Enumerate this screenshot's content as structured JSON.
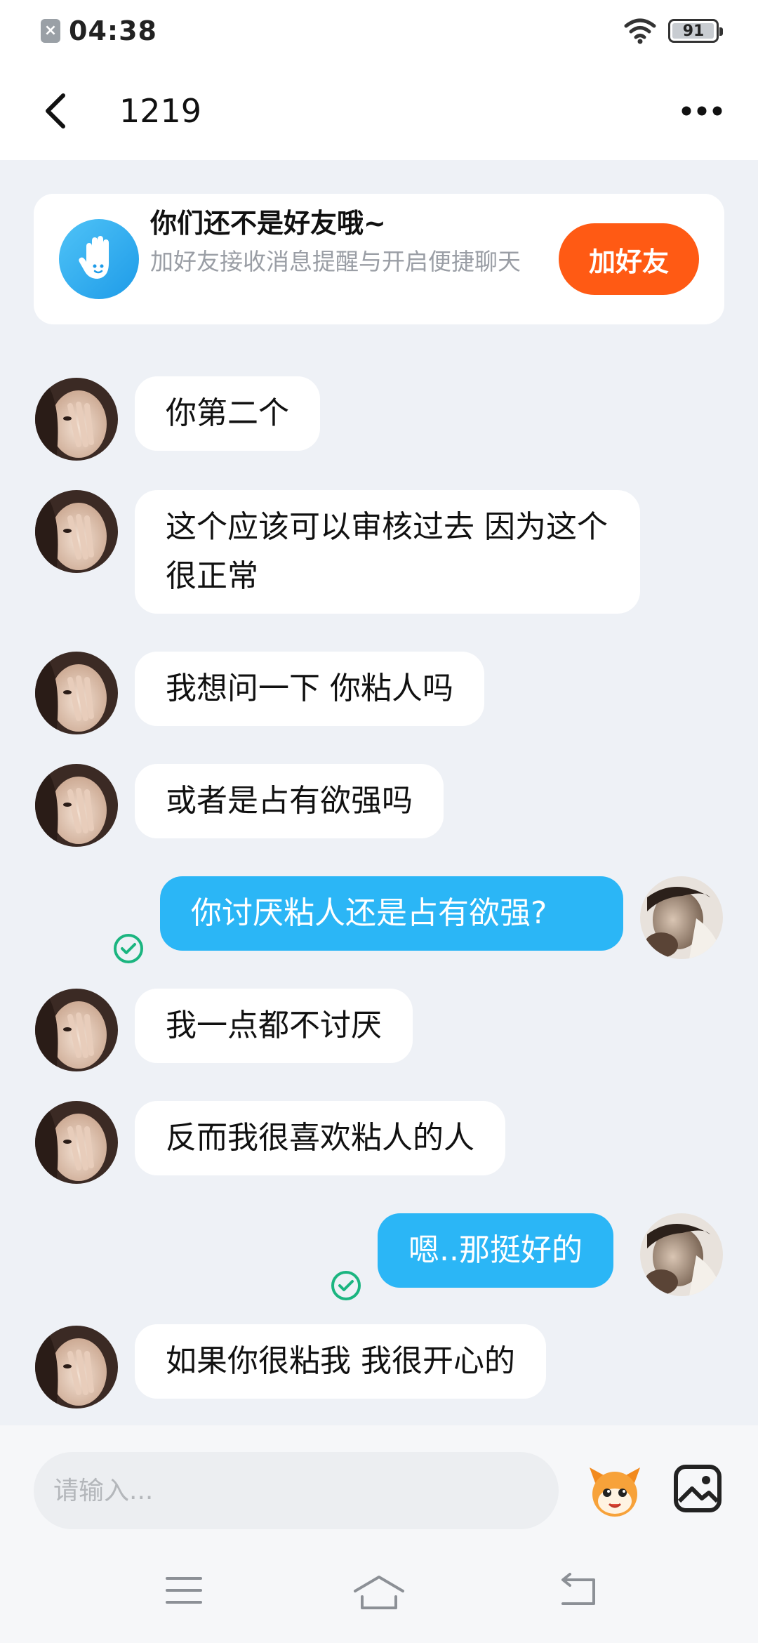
{
  "status_bar": {
    "time": "04:38",
    "battery_level": "91",
    "icons": [
      "notification-dismissed-icon",
      "wifi-icon",
      "battery-icon"
    ]
  },
  "header": {
    "title": "1219",
    "back_icon": "chevron-left-icon",
    "more_icon": "more-dots-icon"
  },
  "friend_banner": {
    "title": "你们还不是好友哦~",
    "subtitle": "加好友接收消息提醒与开启便捷聊天",
    "button_label": "加好友",
    "icon": "hand-wave-icon"
  },
  "messages": [
    {
      "side": "left",
      "text": "你第二个"
    },
    {
      "side": "left",
      "text": "这个应该可以审核过去 因为这个很正常"
    },
    {
      "side": "left",
      "text": "我想问一下 你粘人吗"
    },
    {
      "side": "left",
      "text": "或者是占有欲强吗"
    },
    {
      "side": "right",
      "text": "你讨厌粘人还是占有欲强?",
      "status": "sent"
    },
    {
      "side": "left",
      "text": "我一点都不讨厌"
    },
    {
      "side": "left",
      "text": "反而我很喜欢粘人的人"
    },
    {
      "side": "right",
      "text": "嗯..那挺好的",
      "status": "sent"
    },
    {
      "side": "left",
      "text": "如果你很粘我 我很开心的"
    }
  ],
  "input": {
    "placeholder": "请输入...",
    "value": ""
  },
  "toolbar": {
    "icons": [
      "emoji-mascot-icon",
      "image-icon"
    ]
  },
  "nav": {
    "icons": [
      "menu-icon",
      "home-icon",
      "back-icon"
    ]
  },
  "colors": {
    "accent_blue": "#2bb6f6",
    "add_friend_orange": "#ff5a14",
    "sent_check_green": "#1bb580",
    "background": "#eef1f6"
  }
}
